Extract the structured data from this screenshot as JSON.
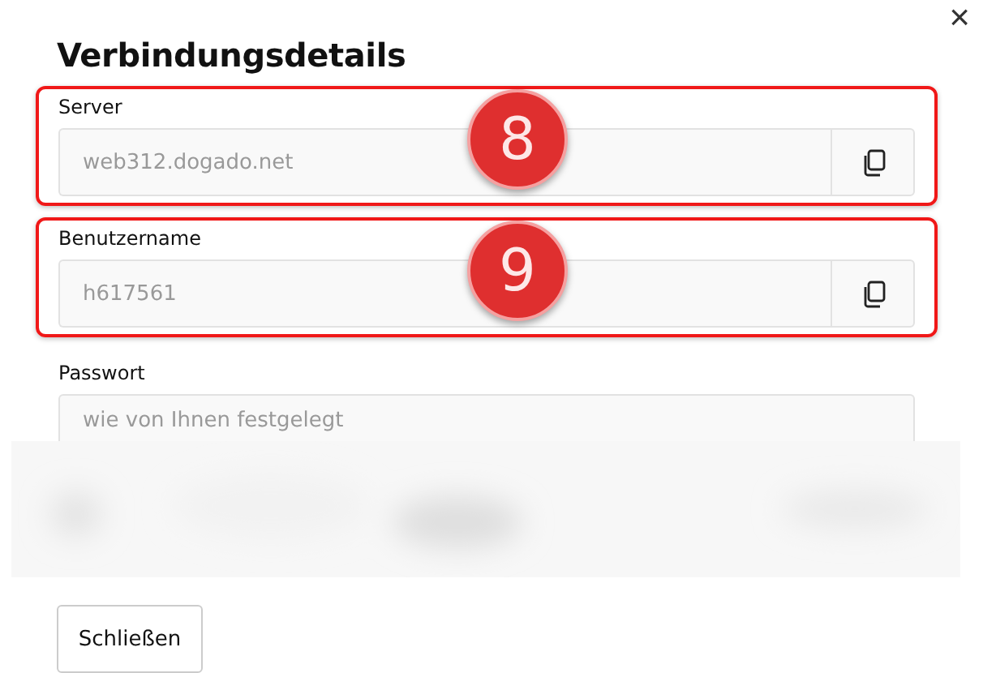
{
  "dialog": {
    "title": "Verbindungsdetails",
    "close_icon": "×"
  },
  "fields": [
    {
      "label": "Server",
      "value": "web312.dogado.net",
      "readonly": true,
      "copyable": true,
      "callout": "8"
    },
    {
      "label": "Benutzername",
      "value": "h617561",
      "readonly": true,
      "copyable": true,
      "callout": "9"
    },
    {
      "label": "Passwort",
      "placeholder": "wie von Ihnen festgelegt",
      "copyable": false
    }
  ],
  "redacted": true,
  "buttons": [
    "Schließen"
  ]
}
